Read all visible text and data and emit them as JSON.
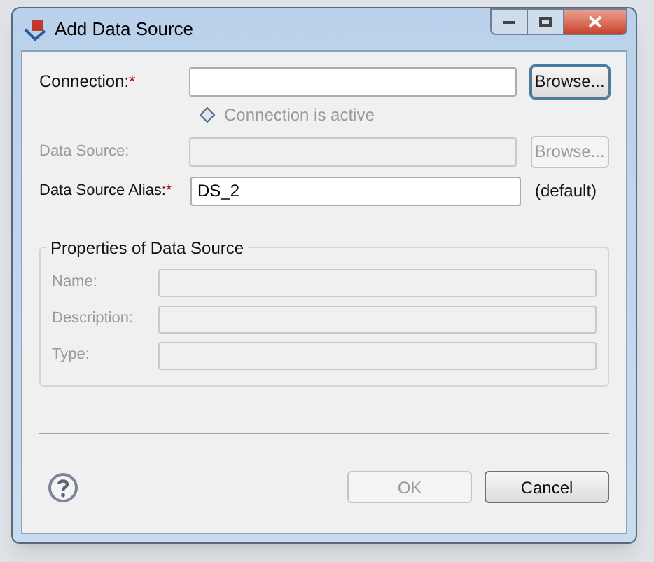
{
  "window": {
    "title": "Add Data Source"
  },
  "connection": {
    "label": "Connection:",
    "required_mark": "*",
    "disabled": false,
    "button": "Browse...",
    "button_disabled": false
  },
  "status": {
    "text": "Connection is active",
    "disabled": true
  },
  "data_source": {
    "label": "Data Source:",
    "disabled": true,
    "button": "Browse...",
    "button_disabled": true
  },
  "alias": {
    "label": "Data Source Alias:",
    "required_mark": "*",
    "value": "DS_2",
    "note": "(default)"
  },
  "properties": {
    "title": "Properties of Data Source",
    "fields": [
      {
        "label": "Name:",
        "disabled": true
      },
      {
        "label": "Description:",
        "disabled": true
      },
      {
        "label": "Type:",
        "disabled": true
      }
    ]
  },
  "buttons": [
    {
      "label": "OK",
      "disabled": true
    },
    {
      "label": "Cancel",
      "disabled": false
    }
  ]
}
